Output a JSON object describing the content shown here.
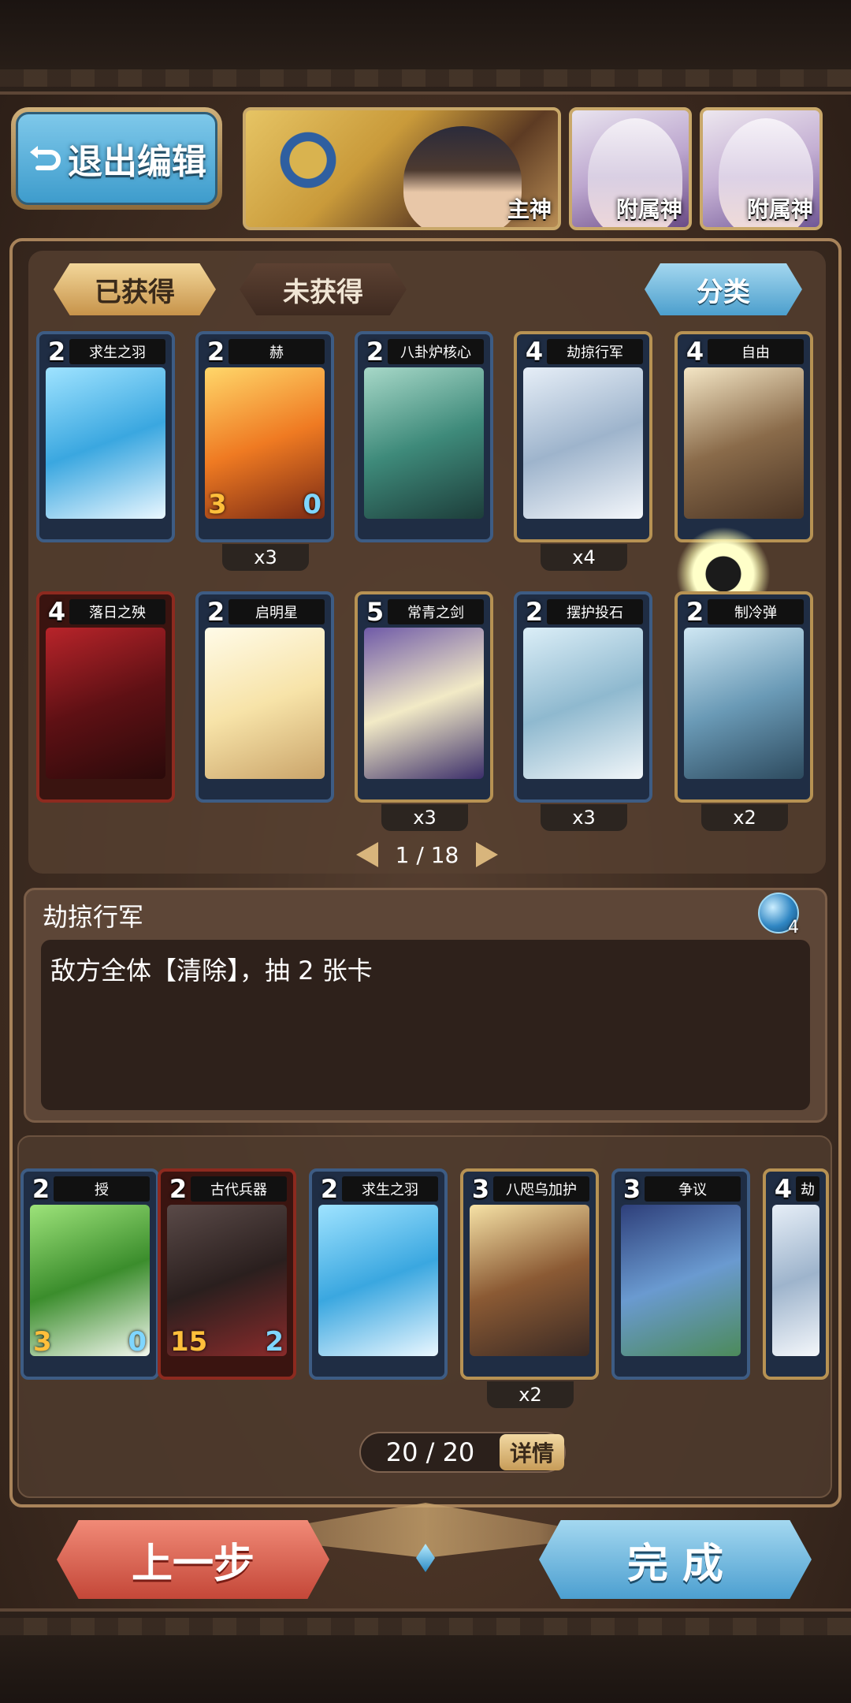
{
  "header": {
    "exit_label": "退出编辑",
    "gods": [
      {
        "role": "主神"
      },
      {
        "role": "附属神"
      },
      {
        "role": "附属神"
      }
    ]
  },
  "tabs": {
    "obtained": "已获得",
    "not_obtained": "未获得",
    "sort": "分类"
  },
  "collection": {
    "cards": [
      {
        "cost": "2",
        "name": "求生之羽",
        "count": ""
      },
      {
        "cost": "2",
        "name": "赫",
        "attack": "3",
        "health": "0",
        "count": "x3"
      },
      {
        "cost": "2",
        "name": "八卦炉核心",
        "count": ""
      },
      {
        "cost": "4",
        "name": "劫掠行军",
        "count": "x4"
      },
      {
        "cost": "4",
        "name": "自由",
        "count": ""
      },
      {
        "cost": "4",
        "name": "落日之殃",
        "count": ""
      },
      {
        "cost": "2",
        "name": "启明星",
        "count": ""
      },
      {
        "cost": "5",
        "name": "常青之剑",
        "count": "x3"
      },
      {
        "cost": "2",
        "name": "摆护投石",
        "count": "x3"
      },
      {
        "cost": "2",
        "name": "制冷弹",
        "count": "x2"
      }
    ],
    "page": "1 / 18"
  },
  "detail": {
    "title": "劫掠行军",
    "text": "敌方全体【清除】，抽 2 张卡",
    "mana": "4"
  },
  "deck": {
    "cards": [
      {
        "cost": "2",
        "name": "授",
        "attack": "3",
        "health": "0",
        "count": ""
      },
      {
        "cost": "2",
        "name": "古代兵器",
        "attack": "15",
        "health": "2",
        "count": ""
      },
      {
        "cost": "2",
        "name": "求生之羽",
        "count": ""
      },
      {
        "cost": "3",
        "name": "八咫乌加护",
        "count": "x2"
      },
      {
        "cost": "3",
        "name": "争议",
        "count": ""
      },
      {
        "cost": "4",
        "name": "劫",
        "count": ""
      }
    ],
    "counter": "20 / 20",
    "detail_label": "详情"
  },
  "footer": {
    "prev_label": "上一步",
    "done_label": "完 成"
  }
}
